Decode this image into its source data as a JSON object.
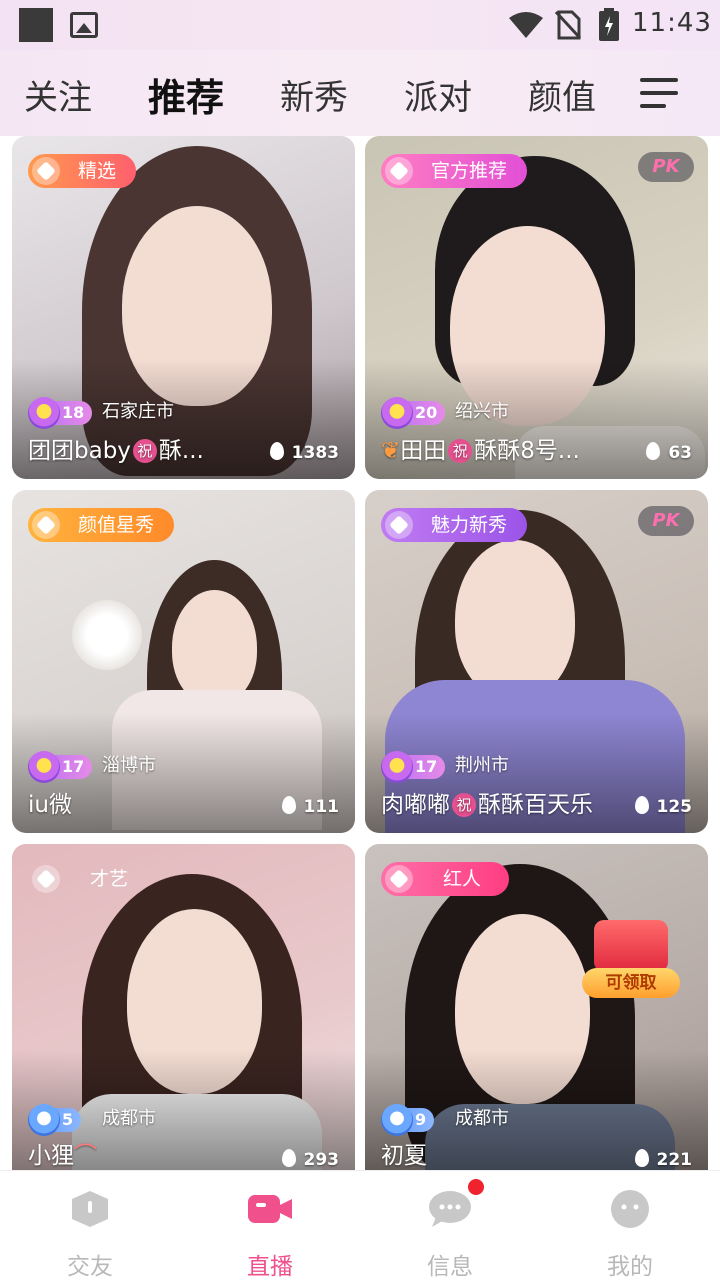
{
  "status_bar": {
    "time": "11:43"
  },
  "top_tabs": [
    {
      "label": "关注",
      "active": false
    },
    {
      "label": "推荐",
      "active": true
    },
    {
      "label": "新秀",
      "active": false
    },
    {
      "label": "派对",
      "active": false
    },
    {
      "label": "颜值",
      "active": false
    }
  ],
  "cards": [
    {
      "tag": "精选",
      "tag_color": "#ff7a3d",
      "pk": false,
      "level": "18",
      "city": "石家庄市",
      "name": "团团baby",
      "name_suffix": "酥...",
      "has_zhu": true,
      "heat": "1383"
    },
    {
      "tag": "官方推荐",
      "tag_color": "#ff5bb6",
      "pk": true,
      "level": "20",
      "city": "绍兴市",
      "name": "田田",
      "name_suffix": "酥酥8号...",
      "has_zhu": true,
      "heat": "63"
    },
    {
      "tag": "颜值星秀",
      "tag_color": "#ff9a1f",
      "pk": false,
      "level": "17",
      "city": "淄博市",
      "name": "iu微",
      "name_suffix": "",
      "has_zhu": false,
      "heat": "111"
    },
    {
      "tag": "魅力新秀",
      "tag_color": "#b25cf0",
      "pk": true,
      "level": "17",
      "city": "荆州市",
      "name": "肉嘟嘟",
      "name_suffix": "酥酥百天乐",
      "has_zhu": true,
      "heat": "125"
    },
    {
      "tag": "才艺",
      "tag_color": "#ff4aa8",
      "pk": false,
      "level": "5",
      "city": "成都市",
      "name": "小狸",
      "name_suffix": "",
      "has_zhu": false,
      "heat": "293"
    },
    {
      "tag": "红人",
      "tag_color": "#ff4a8d",
      "pk": false,
      "level": "9",
      "city": "成都市",
      "name": "初夏",
      "name_suffix": "",
      "has_zhu": false,
      "heat": "221"
    }
  ],
  "pk_label": "PK",
  "zhu_label": "祝",
  "gift_label": "可领取",
  "bottom_nav": [
    {
      "label": "交友",
      "active": false
    },
    {
      "label": "直播",
      "active": true
    },
    {
      "label": "信息",
      "active": false,
      "has_dot": true
    },
    {
      "label": "我的",
      "active": false
    }
  ],
  "colors": {
    "accent": "#f0508c",
    "inactive": "#b8b8b8"
  }
}
